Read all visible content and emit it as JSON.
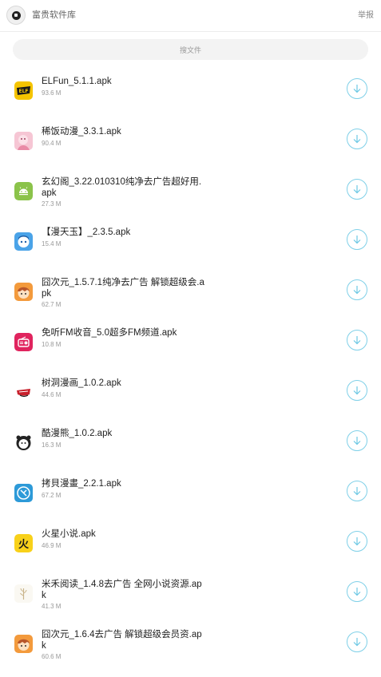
{
  "header": {
    "title": "富贵软件库",
    "report_label": "举报"
  },
  "search": {
    "placeholder": "搜文件"
  },
  "files": [
    {
      "name": "ELFun_5.1.1.apk",
      "size": "93.6 M",
      "icon": "elfun-app-icon",
      "color": "#f5c400"
    },
    {
      "name": "稀饭动漫_3.3.1.apk",
      "size": "90.4 M",
      "icon": "xifan-anime-app-icon",
      "color": "#f6c6d4"
    },
    {
      "name": "玄幻阁_3.22.010310纯净去广告超好用.apk",
      "size": "27.3 M",
      "icon": "android-app-icon",
      "color": "#8bc34a"
    },
    {
      "name": "【漫天玉】_2.3.5.apk",
      "size": "15.4 M",
      "icon": "mantianyu-app-icon",
      "color": "#4aa3e8"
    },
    {
      "name": "囧次元_1.5.7.1纯净去广告 解锁超级会.apk",
      "size": "62.7 M",
      "icon": "jiongciyuan-app-icon",
      "color": "#f39a3c"
    },
    {
      "name": "免听FM收音_5.0超多FM频道.apk",
      "size": "10.8 M",
      "icon": "radio-app-icon",
      "color": "#e0245e"
    },
    {
      "name": "树洞漫画_1.0.2.apk",
      "size": "44.6 M",
      "icon": "shudong-comic-app-icon",
      "color": "#c8202c"
    },
    {
      "name": "酷漫熊_1.0.2.apk",
      "size": "16.3 M",
      "icon": "kumanxiong-app-icon",
      "color": "#222222"
    },
    {
      "name": "拷貝漫畫_2.2.1.apk",
      "size": "67.2 M",
      "icon": "kaobei-comic-app-icon",
      "color": "#2d9ad8"
    },
    {
      "name": "火星小说.apk",
      "size": "46.9 M",
      "icon": "mars-novel-app-icon",
      "color": "#f8d11a"
    },
    {
      "name": "米禾阅读_1.4.8去广告 全网小说资源.apk",
      "size": "41.3 M",
      "icon": "mihe-reading-app-icon",
      "color": "#c9b48a"
    },
    {
      "name": "囧次元_1.6.4去广告 解锁超级会员资.apk",
      "size": "60.6 M",
      "icon": "jiongciyuan-app-icon",
      "color": "#f39a3c"
    }
  ]
}
